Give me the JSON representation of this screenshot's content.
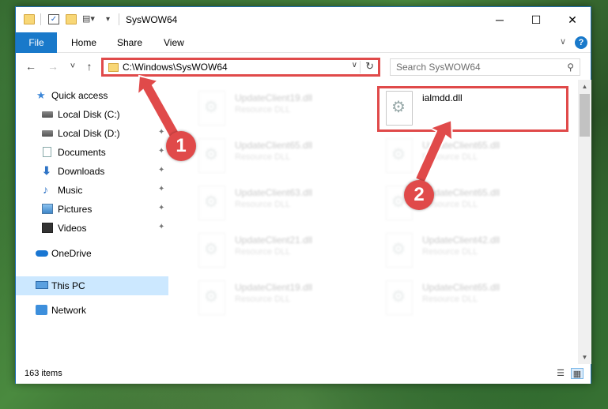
{
  "window": {
    "title": "SysWOW64",
    "minimize_icon": "minimize-icon",
    "maximize_icon": "maximize-icon",
    "close_icon": "close-icon",
    "minimize_glyph": "─",
    "maximize_glyph": "☐",
    "close_glyph": "✕"
  },
  "ribbon": {
    "tabs": [
      "File",
      "Home",
      "Share",
      "View"
    ],
    "expand_glyph": "∨",
    "help_glyph": "?"
  },
  "navigation": {
    "back_glyph": "←",
    "forward_glyph": "→",
    "recent_glyph": "˅",
    "up_glyph": "↑"
  },
  "address": {
    "path": "C:\\Windows\\SysWOW64",
    "dropdown_glyph": "∨",
    "refresh_glyph": "↻"
  },
  "search": {
    "placeholder": "Search SysWOW64",
    "icon_glyph": "⚲"
  },
  "nav_pane": {
    "items": [
      {
        "label": "Quick access",
        "icon": "star-icon",
        "pinned": false
      },
      {
        "label": "Local Disk (C:)",
        "icon": "disk-icon",
        "pinned": true
      },
      {
        "label": "Local Disk (D:)",
        "icon": "disk-icon",
        "pinned": true
      },
      {
        "label": "Documents",
        "icon": "documents-icon",
        "pinned": true
      },
      {
        "label": "Downloads",
        "icon": "downloads-icon",
        "pinned": true
      },
      {
        "label": "Music",
        "icon": "music-icon",
        "pinned": true
      },
      {
        "label": "Pictures",
        "icon": "pictures-icon",
        "pinned": true
      },
      {
        "label": "Videos",
        "icon": "videos-icon",
        "pinned": true
      },
      {
        "label": "OneDrive",
        "icon": "onedrive-icon",
        "pinned": false
      },
      {
        "label": "This PC",
        "icon": "this-pc-icon",
        "pinned": false,
        "selected": true
      },
      {
        "label": "Network",
        "icon": "network-icon",
        "pinned": false
      }
    ],
    "pin_glyph": "📌"
  },
  "files": [
    {
      "name": "UpdateClient19.dll",
      "type": "Resource DLL",
      "highlighted": false
    },
    {
      "name": "ialmdd.dll",
      "type": "",
      "highlighted": true
    },
    {
      "name": "UpdateClient65.dll",
      "type": "Resource DLL",
      "highlighted": false
    },
    {
      "name": "UpdateClient65.dll",
      "type": "Resource DLL",
      "highlighted": false
    },
    {
      "name": "UpdateClient63.dll",
      "type": "Resource DLL",
      "highlighted": false
    },
    {
      "name": "UpdateClient65.dll",
      "type": "Resource DLL",
      "highlighted": false
    },
    {
      "name": "UpdateClient21.dll",
      "type": "Resource DLL",
      "highlighted": false
    },
    {
      "name": "UpdateClient42.dll",
      "type": "Resource DLL",
      "highlighted": false
    },
    {
      "name": "UpdateClient19.dll",
      "type": "Resource DLL",
      "highlighted": false
    },
    {
      "name": "UpdateClient65.dll",
      "type": "Resource DLL",
      "highlighted": false
    }
  ],
  "file_icon_glyph": "⚙",
  "status": {
    "item_count": "163 items",
    "details_view_glyph": "☰",
    "tiles_view_glyph": "▦"
  },
  "scrollbar": {
    "up_glyph": "▲",
    "down_glyph": "▼"
  },
  "annotations": {
    "step1": "1",
    "step2": "2",
    "color": "#e04a4a"
  }
}
